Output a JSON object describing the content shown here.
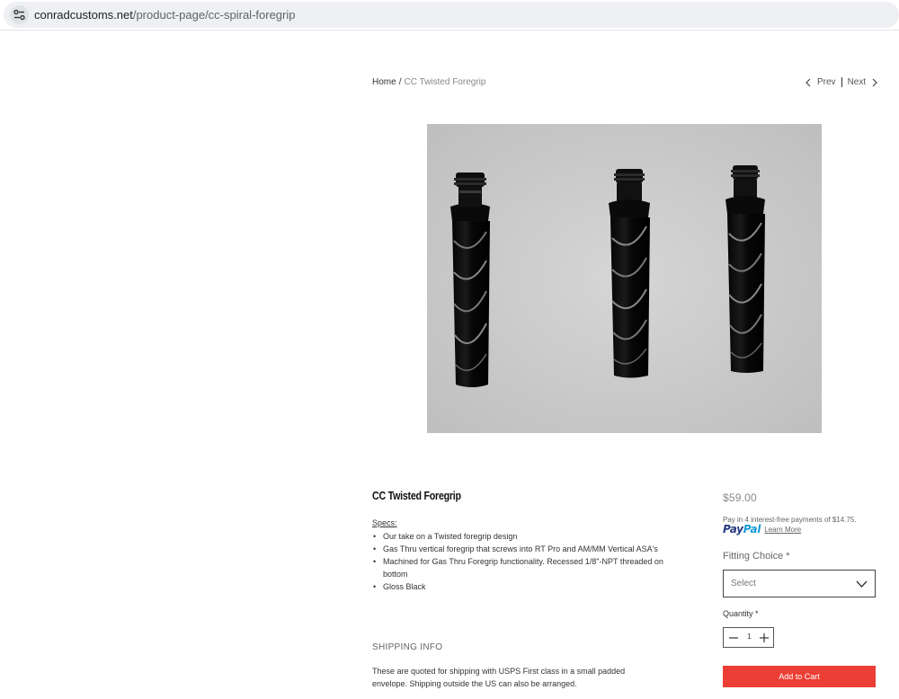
{
  "browser": {
    "url_host": "conradcustoms.net",
    "url_path": "/product-page/cc-spiral-foregrip"
  },
  "breadcrumb": {
    "home": "Home",
    "separator": "/",
    "current": "CC Twisted Foregrip"
  },
  "pager": {
    "prev": "Prev",
    "next": "Next"
  },
  "product": {
    "title": "CC Twisted Foregrip",
    "specs_label": "Specs:",
    "specs": [
      "Our take on a Twisted foregrip design",
      "Gas Thru vertical foregrip that screws into RT Pro and AM/MM Vertical ASA's",
      "Machined for Gas Thru Foregrip functionality. Recessed 1/8\"-NPT threaded on bottom",
      "Gloss Black"
    ],
    "shipping_title": "SHIPPING INFO",
    "shipping_text": "These are quoted for shipping with USPS First class in a small padded envelope. Shipping outside the US can also be arranged."
  },
  "purchase": {
    "price": "$59.00",
    "paypal_text": "Pay in 4 interest-free payments of $14.75.",
    "paypal_pay": "Pay",
    "paypal_pal": "Pal",
    "learn_more": "Learn More",
    "fitting_label": "Fitting Choice *",
    "fitting_value": "Select",
    "quantity_label": "Quantity *",
    "quantity_value": "1",
    "add_to_cart": "Add to Cart"
  },
  "colors": {
    "accent_button": "#ec3e34",
    "paypal_dark": "#253b80",
    "paypal_light": "#179bd7"
  },
  "icons": [
    "site-settings-icon",
    "chevron-left-icon",
    "chevron-right-icon",
    "chevron-down-icon",
    "minus-icon",
    "plus-icon"
  ]
}
